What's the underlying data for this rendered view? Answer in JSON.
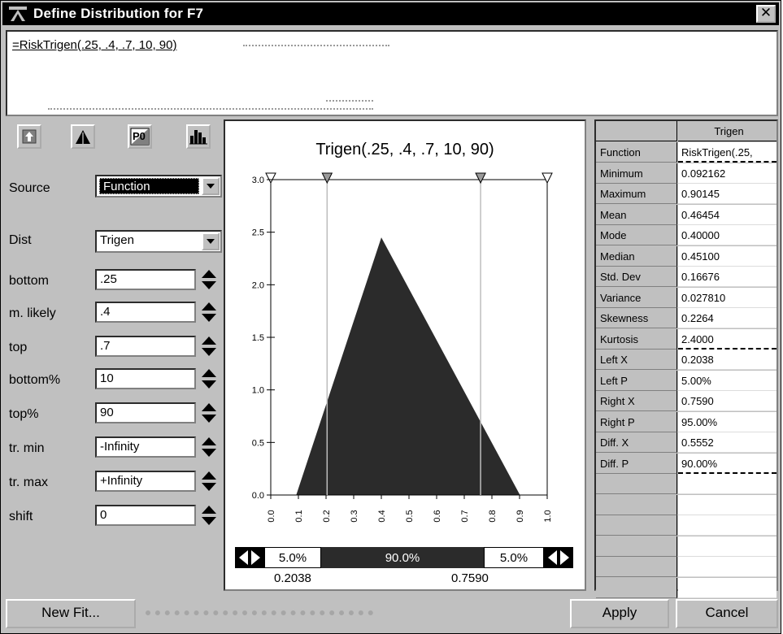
{
  "window": {
    "title": "Define Distribution for F7",
    "close_symbol": "✕"
  },
  "formula": {
    "text": "=RiskTrigen(.25, .4, .7, 10, 90)"
  },
  "toolbar": {
    "icons": [
      "copy-up-icon",
      "distribution-icon",
      "p0-icon",
      "histogram-icon"
    ],
    "p0_label": "P0"
  },
  "params": {
    "source_label": "Source",
    "source_value": "Function",
    "dist_label": "Dist",
    "dist_value": "Trigen",
    "fields": [
      {
        "label": "bottom",
        "value": ".25"
      },
      {
        "label": "m. likely",
        "value": ".4"
      },
      {
        "label": "top",
        "value": ".7"
      },
      {
        "label": "bottom%",
        "value": "10"
      },
      {
        "label": "top%",
        "value": "90"
      },
      {
        "label": "tr. min",
        "value": "-Infinity"
      },
      {
        "label": "tr. max",
        "value": "+Infinity"
      },
      {
        "label": "shift",
        "value": "0"
      }
    ]
  },
  "chart_data": {
    "type": "area",
    "title": "Trigen(.25, .4, .7, 10, 90)",
    "x": [
      0.092162,
      0.4,
      0.90145
    ],
    "y": [
      0,
      2.45,
      0
    ],
    "xlim": [
      0.0,
      1.0
    ],
    "ylim": [
      0.0,
      3.0
    ],
    "xticks": [
      "0.0",
      "0.1",
      "0.2",
      "0.3",
      "0.4",
      "0.5",
      "0.6",
      "0.7",
      "0.8",
      "0.9",
      "1.0"
    ],
    "yticks": [
      "0.0",
      "0.5",
      "1.0",
      "1.5",
      "2.0",
      "2.5",
      "3.0"
    ],
    "markers": [
      0.0,
      0.2038,
      0.759,
      1.0
    ],
    "fill_color": "#2b2b2b"
  },
  "probability_bar": {
    "left_pct": "5.0%",
    "middle_pct": "90.0%",
    "right_pct": "5.0%",
    "left_x": "0.2038",
    "right_x": "0.7590",
    "left_fraction": 0.05,
    "middle_fraction": 0.9,
    "right_fraction": 0.05
  },
  "stats": {
    "column_header": "Trigen",
    "rows": [
      {
        "label": "Function",
        "value": "RiskTrigen(.25,"
      },
      {
        "label": "Minimum",
        "value": "0.092162"
      },
      {
        "label": "Maximum",
        "value": "0.90145"
      },
      {
        "label": "Mean",
        "value": "0.46454"
      },
      {
        "label": "Mode",
        "value": "0.40000"
      },
      {
        "label": "Median",
        "value": "0.45100"
      },
      {
        "label": "Std. Dev",
        "value": "0.16676"
      },
      {
        "label": "Variance",
        "value": "0.027810"
      },
      {
        "label": "Skewness",
        "value": "0.2264"
      },
      {
        "label": "Kurtosis",
        "value": "2.4000"
      },
      {
        "label": "Left X",
        "value": "0.2038"
      },
      {
        "label": "Left P",
        "value": "5.00%"
      },
      {
        "label": "Right X",
        "value": "0.7590"
      },
      {
        "label": "Right P",
        "value": "95.00%"
      },
      {
        "label": "Diff. X",
        "value": "0.5552"
      },
      {
        "label": "Diff. P",
        "value": "90.00%"
      }
    ],
    "empty_rows": 6
  },
  "footer": {
    "new_fit": "New Fit...",
    "apply": "Apply",
    "cancel": "Cancel"
  }
}
